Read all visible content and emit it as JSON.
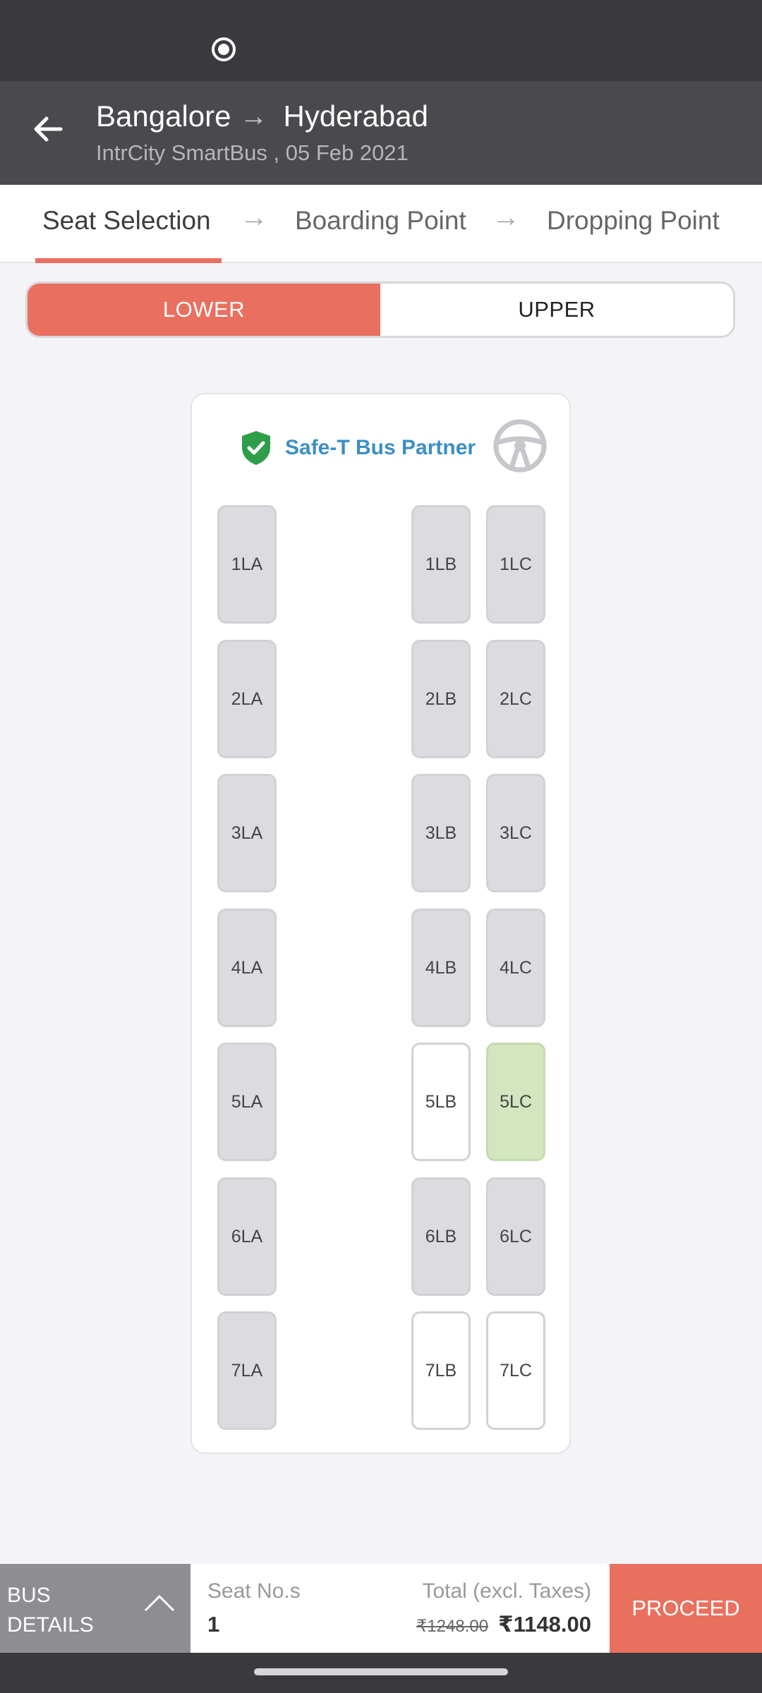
{
  "header": {
    "from": "Bangalore",
    "to": "Hyderabad",
    "subtitle": "IntrCity SmartBus , 05 Feb 2021"
  },
  "steps": [
    {
      "label": "Seat Selection",
      "active": true
    },
    {
      "label": "Boarding Point",
      "active": false
    },
    {
      "label": "Dropping Point",
      "active": false
    }
  ],
  "deck": {
    "lower_label": "LOWER",
    "upper_label": "UPPER",
    "selected": "LOWER"
  },
  "bus_layout": {
    "partner_label": "Safe-T Bus Partner",
    "rows": [
      [
        {
          "id": "1LA",
          "state": "booked"
        },
        {
          "id": "1LB",
          "state": "booked"
        },
        {
          "id": "1LC",
          "state": "booked"
        }
      ],
      [
        {
          "id": "2LA",
          "state": "booked"
        },
        {
          "id": "2LB",
          "state": "booked"
        },
        {
          "id": "2LC",
          "state": "booked"
        }
      ],
      [
        {
          "id": "3LA",
          "state": "booked"
        },
        {
          "id": "3LB",
          "state": "booked"
        },
        {
          "id": "3LC",
          "state": "booked"
        }
      ],
      [
        {
          "id": "4LA",
          "state": "booked"
        },
        {
          "id": "4LB",
          "state": "booked"
        },
        {
          "id": "4LC",
          "state": "booked"
        }
      ],
      [
        {
          "id": "5LA",
          "state": "booked"
        },
        {
          "id": "5LB",
          "state": "available"
        },
        {
          "id": "5LC",
          "state": "ladies"
        }
      ],
      [
        {
          "id": "6LA",
          "state": "booked"
        },
        {
          "id": "6LB",
          "state": "booked"
        },
        {
          "id": "6LC",
          "state": "booked"
        }
      ],
      [
        {
          "id": "7LA",
          "state": "booked"
        },
        {
          "id": "7LB",
          "state": "available"
        },
        {
          "id": "7LC",
          "state": "available"
        }
      ]
    ]
  },
  "footer": {
    "bus_details_label": "BUS DETAILS",
    "seat_label": "Seat No.s",
    "seat_value": "1",
    "total_label": "Total (excl. Taxes)",
    "old_price": "₹1248.00",
    "new_price": "₹1148.00",
    "proceed_label": "PROCEED"
  },
  "colors": {
    "accent": "#e9705f",
    "header_bg": "#4a494d",
    "seat_booked": "#dcdbe0",
    "seat_available": "#ffffff",
    "seat_ladies": "#d3e6bf",
    "partner_text": "#3b8fc4"
  },
  "icons": [
    "back-arrow-icon",
    "arrow-right-icon",
    "shield-check-icon",
    "steering-wheel-icon",
    "chevron-up-icon"
  ]
}
